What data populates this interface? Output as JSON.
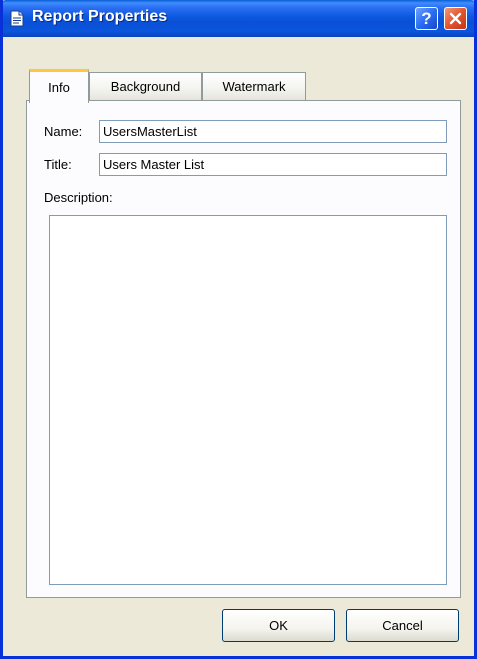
{
  "window": {
    "title": "Report Properties",
    "icon": "report-document-icon",
    "title_buttons": [
      {
        "name": "help",
        "glyph": "?",
        "color": "#2a6ef2"
      },
      {
        "name": "close",
        "glyph": "close-x",
        "color": "#e1552e"
      }
    ]
  },
  "tabs": [
    {
      "label": "Info",
      "active": true
    },
    {
      "label": "Background",
      "active": false
    },
    {
      "label": "Watermark",
      "active": false
    }
  ],
  "info": {
    "name_label": "Name:",
    "name_value": "UsersMasterList",
    "title_label": "Title:",
    "title_value": "Users Master List",
    "description_label": "Description:",
    "description_value": ""
  },
  "buttons": {
    "ok": "OK",
    "cancel": "Cancel"
  },
  "colors": {
    "titlebar": "#0a50d6",
    "dialog_background": "#ece9d8",
    "active_tab_highlight": "#ffc83c",
    "input_border": "#7f9db9"
  }
}
